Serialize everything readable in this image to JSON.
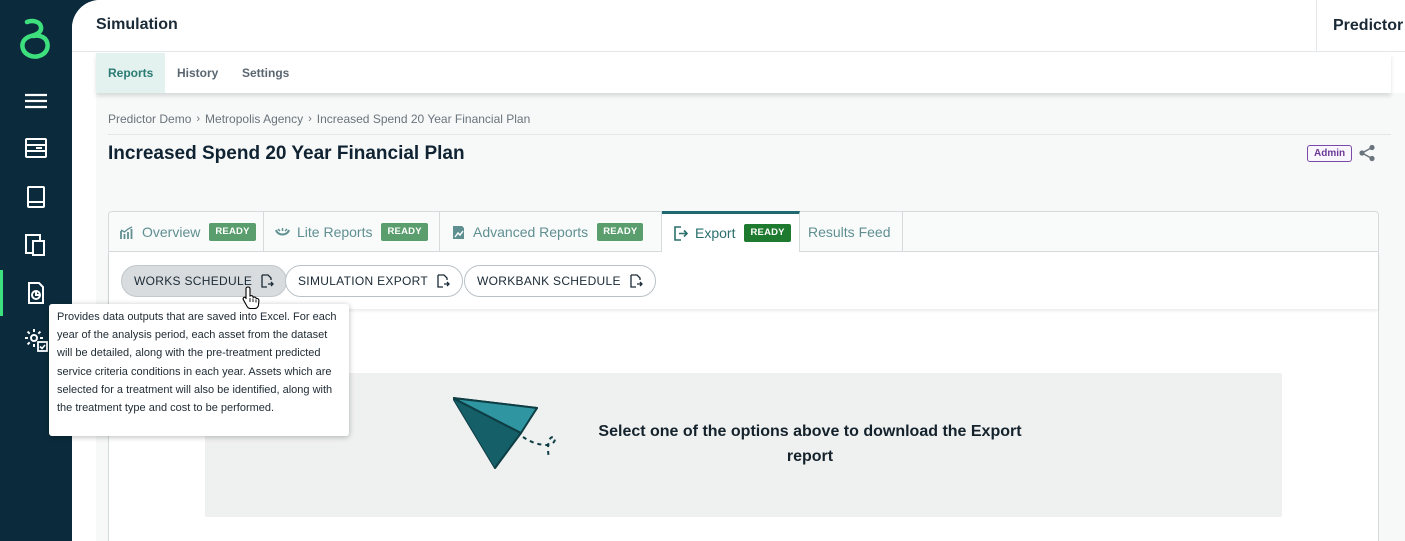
{
  "app": {
    "title": "Simulation",
    "product": "Predictor"
  },
  "sidebar": {
    "items": [
      {
        "name": "menu",
        "icon": "hamburger-icon"
      },
      {
        "name": "networks",
        "icon": "database-icon"
      },
      {
        "name": "library",
        "icon": "book-icon"
      },
      {
        "name": "documents",
        "icon": "documents-icon"
      },
      {
        "name": "reports",
        "icon": "report-icon",
        "active": true
      },
      {
        "name": "settings",
        "icon": "gear-icon"
      }
    ]
  },
  "subnav": {
    "tabs": [
      "Reports",
      "History",
      "Settings"
    ],
    "active": "Reports"
  },
  "breadcrumb": [
    "Predictor Demo",
    "Metropolis Agency",
    "Increased Spend 20 Year Financial Plan"
  ],
  "page": {
    "title": "Increased Spend 20 Year Financial Plan",
    "badge": "Admin"
  },
  "tabs": [
    {
      "label": "Overview",
      "status": "READY",
      "icon": "chart-icon"
    },
    {
      "label": "Lite Reports",
      "status": "READY",
      "icon": "lite-icon"
    },
    {
      "label": "Advanced Reports",
      "status": "READY",
      "icon": "advanced-icon"
    },
    {
      "label": "Export",
      "status": "READY",
      "icon": "export-icon",
      "active": true
    },
    {
      "label": "Results Feed",
      "icon": ""
    }
  ],
  "export_buttons": [
    "WORKS SCHEDULE",
    "SIMULATION EXPORT",
    "WORKBANK SCHEDULE"
  ],
  "tooltip": "Provides data outputs that are saved into Excel. For each year of the analysis period, each asset from the dataset will be detailed, along with the pre-treatment predicted service criteria conditions in each year. Assets which are selected for a treatment will also be identified, along with the treatment type and cost to be performed.",
  "empty_state": {
    "message": "Select one of the options above to download the Export report"
  },
  "colors": {
    "sidebar": "#0b2b3c",
    "accent": "#3ee07e",
    "teal": "#1e6a70",
    "ready": "#5a9e6e",
    "ready_active": "#1e7a2e"
  }
}
